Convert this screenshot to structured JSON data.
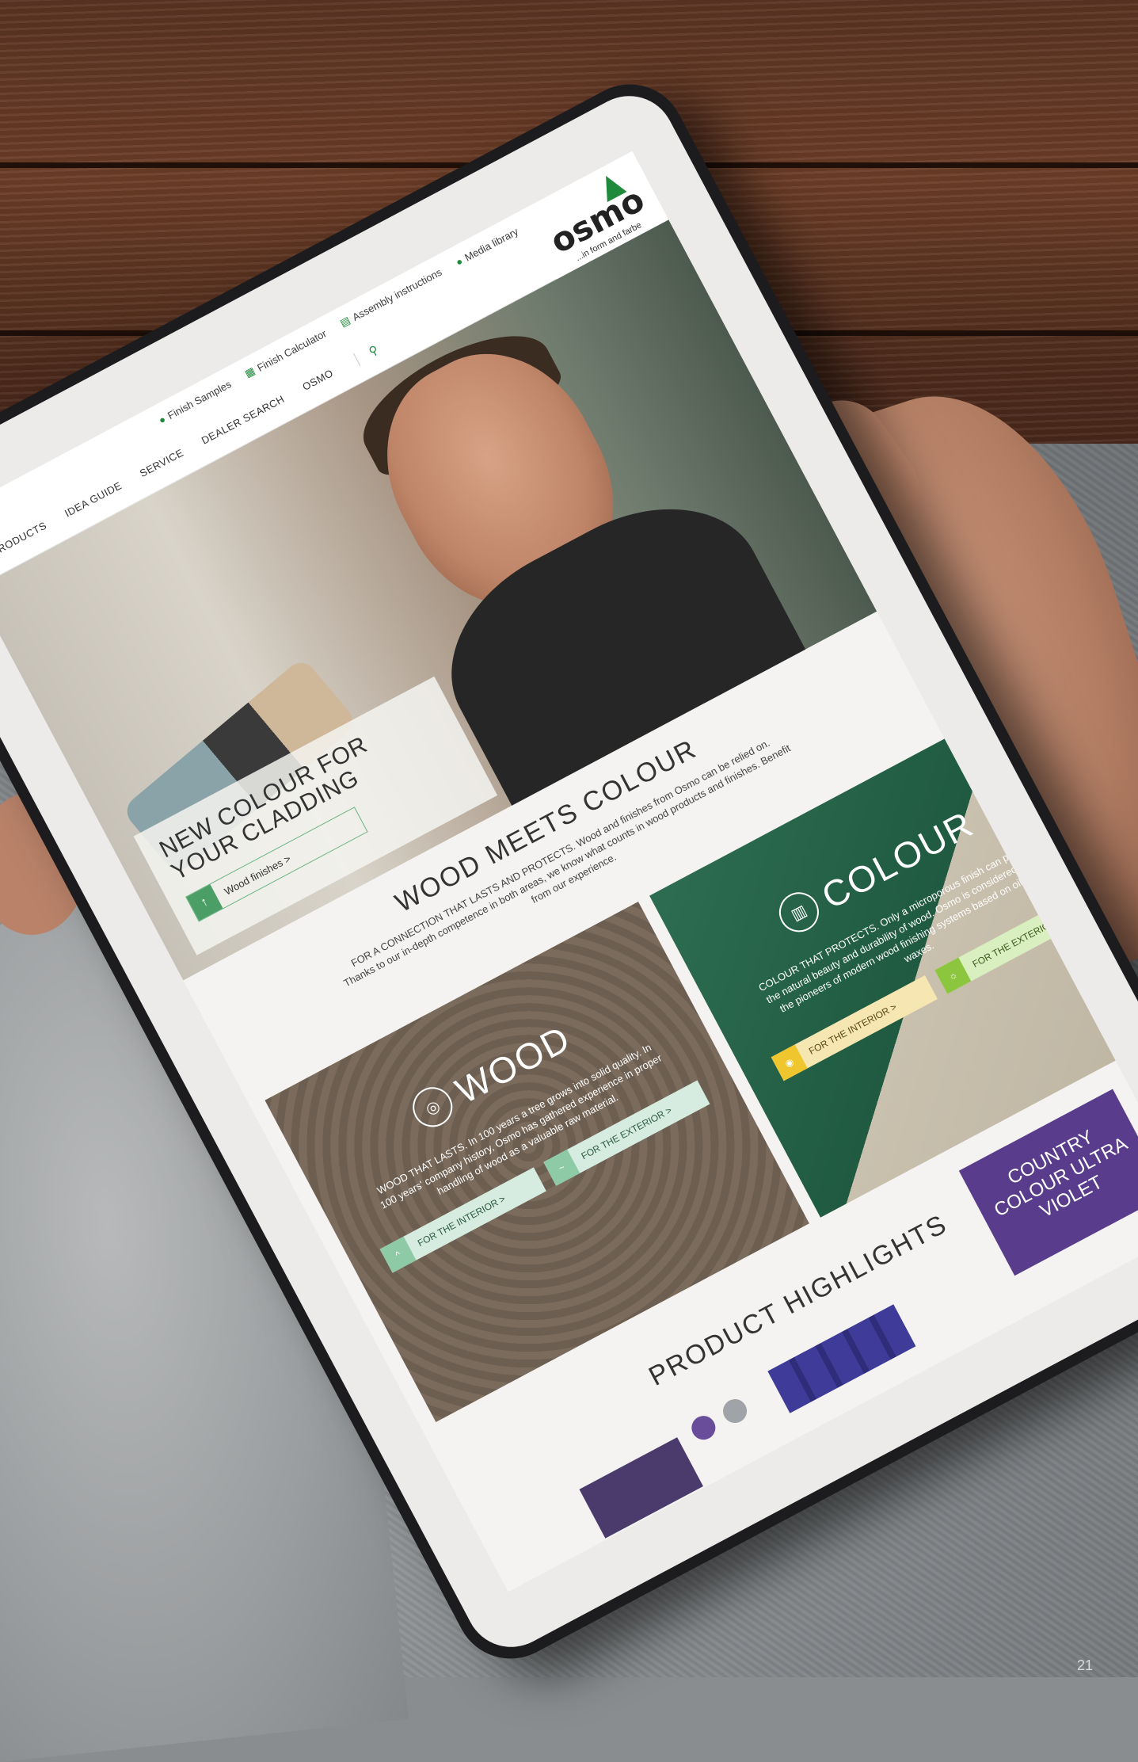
{
  "topbar": {
    "tools": [
      {
        "label": "Finish Samples",
        "icon": "leaf-icon"
      },
      {
        "label": "Finish Calculator",
        "icon": "calculator-icon"
      },
      {
        "label": "Assembly instructions",
        "icon": "document-icon"
      },
      {
        "label": "Media library",
        "icon": "leaf-icon"
      }
    ]
  },
  "nav": {
    "items": [
      "PRODUCTS",
      "IDEA GUIDE",
      "SERVICE",
      "DEALER SEARCH",
      "OSMO"
    ]
  },
  "logo": {
    "wordmark": "osmo",
    "tagline": "...in form and farbe"
  },
  "hero": {
    "title": "NEW COLOUR FOR YOUR CLADDING",
    "button_label": "Wood finishes >"
  },
  "intro": {
    "heading": "WOOD MEETS COLOUR",
    "text": "FOR A CONNECTION THAT LASTS AND PROTECTS. Wood and finishes from Osmo can be relied on. Thanks to our in-depth competence in both areas, we know what counts in wood products and finishes. Benefit from our experience."
  },
  "tiles": [
    {
      "title": "WOOD",
      "text": "WOOD THAT LASTS. In 100 years a tree grows into solid quality. In 100 years' company history, Osmo has gathered experience in proper handling of wood as a valuable raw material.",
      "interior": "FOR THE INTERIOR >",
      "exterior": "FOR THE EXTERIOR >"
    },
    {
      "title": "COLOUR",
      "text": "COLOUR THAT PROTECTS. Only a microporous finish can preserve the natural beauty and durability of wood. Osmo is considered one of the pioneers of modern wood finishing systems based on oils and waxes.",
      "interior": "FOR THE INTERIOR >",
      "exterior": "FOR THE EXTERIOR >"
    }
  ],
  "highlights": {
    "heading": "PRODUCT HIGHLIGHTS",
    "promo": "COUNTRY COLOUR ULTRA VIOLET"
  },
  "page_number": "21",
  "colors": {
    "brand_green": "#1f8a3b",
    "promo_purple": "#5a3c8c",
    "interior_yellow": "#f0c62e",
    "exterior_lime": "#8cc63f"
  }
}
